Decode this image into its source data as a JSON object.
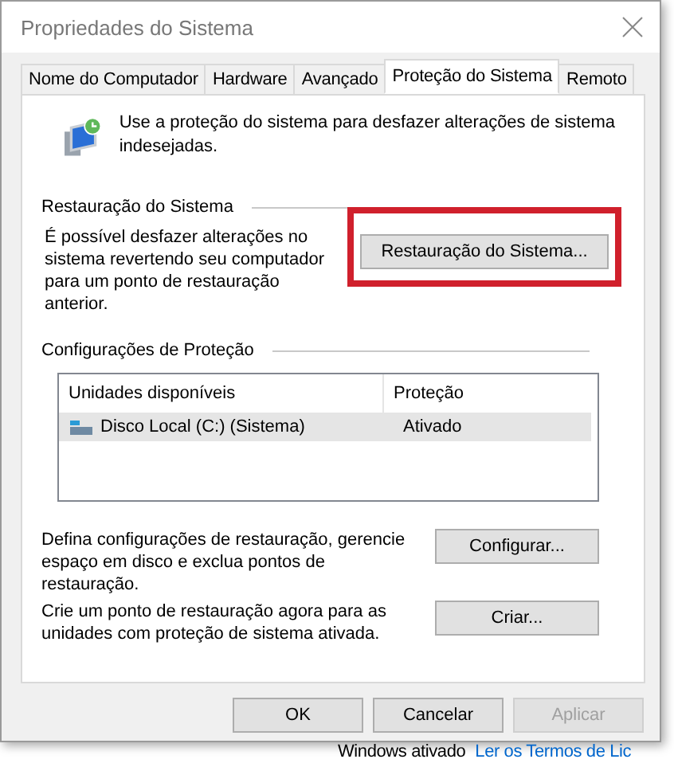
{
  "window": {
    "title": "Propriedades do Sistema"
  },
  "tabs": [
    {
      "label": "Nome do Computador",
      "selected": false
    },
    {
      "label": "Hardware",
      "selected": false
    },
    {
      "label": "Avançado",
      "selected": false
    },
    {
      "label": "Proteção do Sistema",
      "selected": true
    },
    {
      "label": "Remoto",
      "selected": false
    }
  ],
  "intro": "Use a proteção do sistema para desfazer alterações de sistema indesejadas.",
  "restore": {
    "heading": "Restauração do Sistema",
    "text": "É possível desfazer alterações no sistema revertendo seu computador para um ponto de restauração anterior.",
    "button": "Restauração do Sistema...",
    "highlighted": true
  },
  "protection": {
    "heading": "Configurações de Proteção",
    "columns": [
      "Unidades disponíveis",
      "Proteção"
    ],
    "rows": [
      {
        "drive": "Disco Local (C:) (Sistema)",
        "status": "Ativado",
        "selected": true
      }
    ],
    "actions": [
      {
        "text": "Defina configurações de restauração, gerencie espaço em disco e exclua pontos de restauração.",
        "button": "Configurar..."
      },
      {
        "text": "Crie um ponto de restauração agora para as unidades com proteção de sistema ativada.",
        "button": "Criar..."
      }
    ]
  },
  "buttons": [
    {
      "label": "OK",
      "disabled": false
    },
    {
      "label": "Cancelar",
      "disabled": false
    },
    {
      "label": "Aplicar",
      "disabled": true
    }
  ],
  "background": {
    "status": "Windows ativado",
    "link": "Ler os Termos de Lic"
  }
}
